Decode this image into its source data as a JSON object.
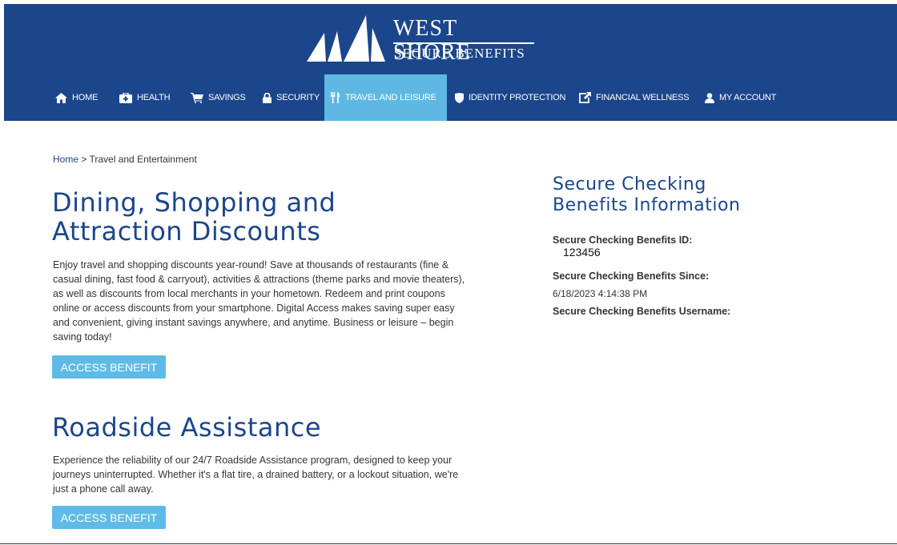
{
  "header": {
    "logo": {
      "title": "WEST SHORE",
      "subtitle": "SECURE BENEFITS"
    },
    "bg_color": "#1b468b",
    "active_color": "#5fb8e3"
  },
  "nav": {
    "items": [
      {
        "label": "HOME",
        "icon": "home-icon"
      },
      {
        "label": "HEALTH",
        "icon": "medical-kit-icon"
      },
      {
        "label": "SAVINGS",
        "icon": "cart-icon"
      },
      {
        "label": "SECURITY",
        "icon": "lock-icon"
      },
      {
        "label": "TRAVEL AND LEISURE",
        "icon": "cutlery-icon",
        "active": true
      },
      {
        "label": "IDENTITY PROTECTION",
        "icon": "shield-icon"
      },
      {
        "label": "FINANCIAL WELLNESS",
        "icon": "external-link-icon"
      },
      {
        "label": "MY ACCOUNT",
        "icon": "user-icon"
      }
    ]
  },
  "breadcrumb": {
    "home": "Home",
    "separator": " > ",
    "current": "Travel and Entertainment"
  },
  "sections": [
    {
      "title_line1": "Dining, Shopping and",
      "title_line2": "Attraction Discounts",
      "body": "Enjoy travel and shopping discounts year-round! Save at thousands of restaurants (fine & casual dining, fast food & carryout), activities & attractions (theme parks and movie theaters), as well as discounts from local merchants in your hometown. Redeem and print coupons online or access discounts from your smartphone. Digital Access makes saving super easy and convenient, giving instant savings anywhere, and anytime. Business or leisure – begin saving today!",
      "button": "ACCESS BENEFIT"
    },
    {
      "title_line1": "Roadside Assistance",
      "body": "Experience the reliability of our 24/7 Roadside Assistance program, designed to keep your journeys uninterrupted. Whether it's a flat tire, a drained battery, or a lockout situation, we're just a phone call away.",
      "button": "ACCESS BENEFIT"
    }
  ],
  "sidebar": {
    "title_line1": "Secure Checking",
    "title_line2": "Benefits Information",
    "id_label": "Secure Checking Benefits ID:",
    "id_value": "123456",
    "since_label": "Secure Checking Benefits Since:",
    "since_value": "6/18/2023 4:14:38 PM",
    "username_label": "Secure Checking Benefits Username:"
  }
}
